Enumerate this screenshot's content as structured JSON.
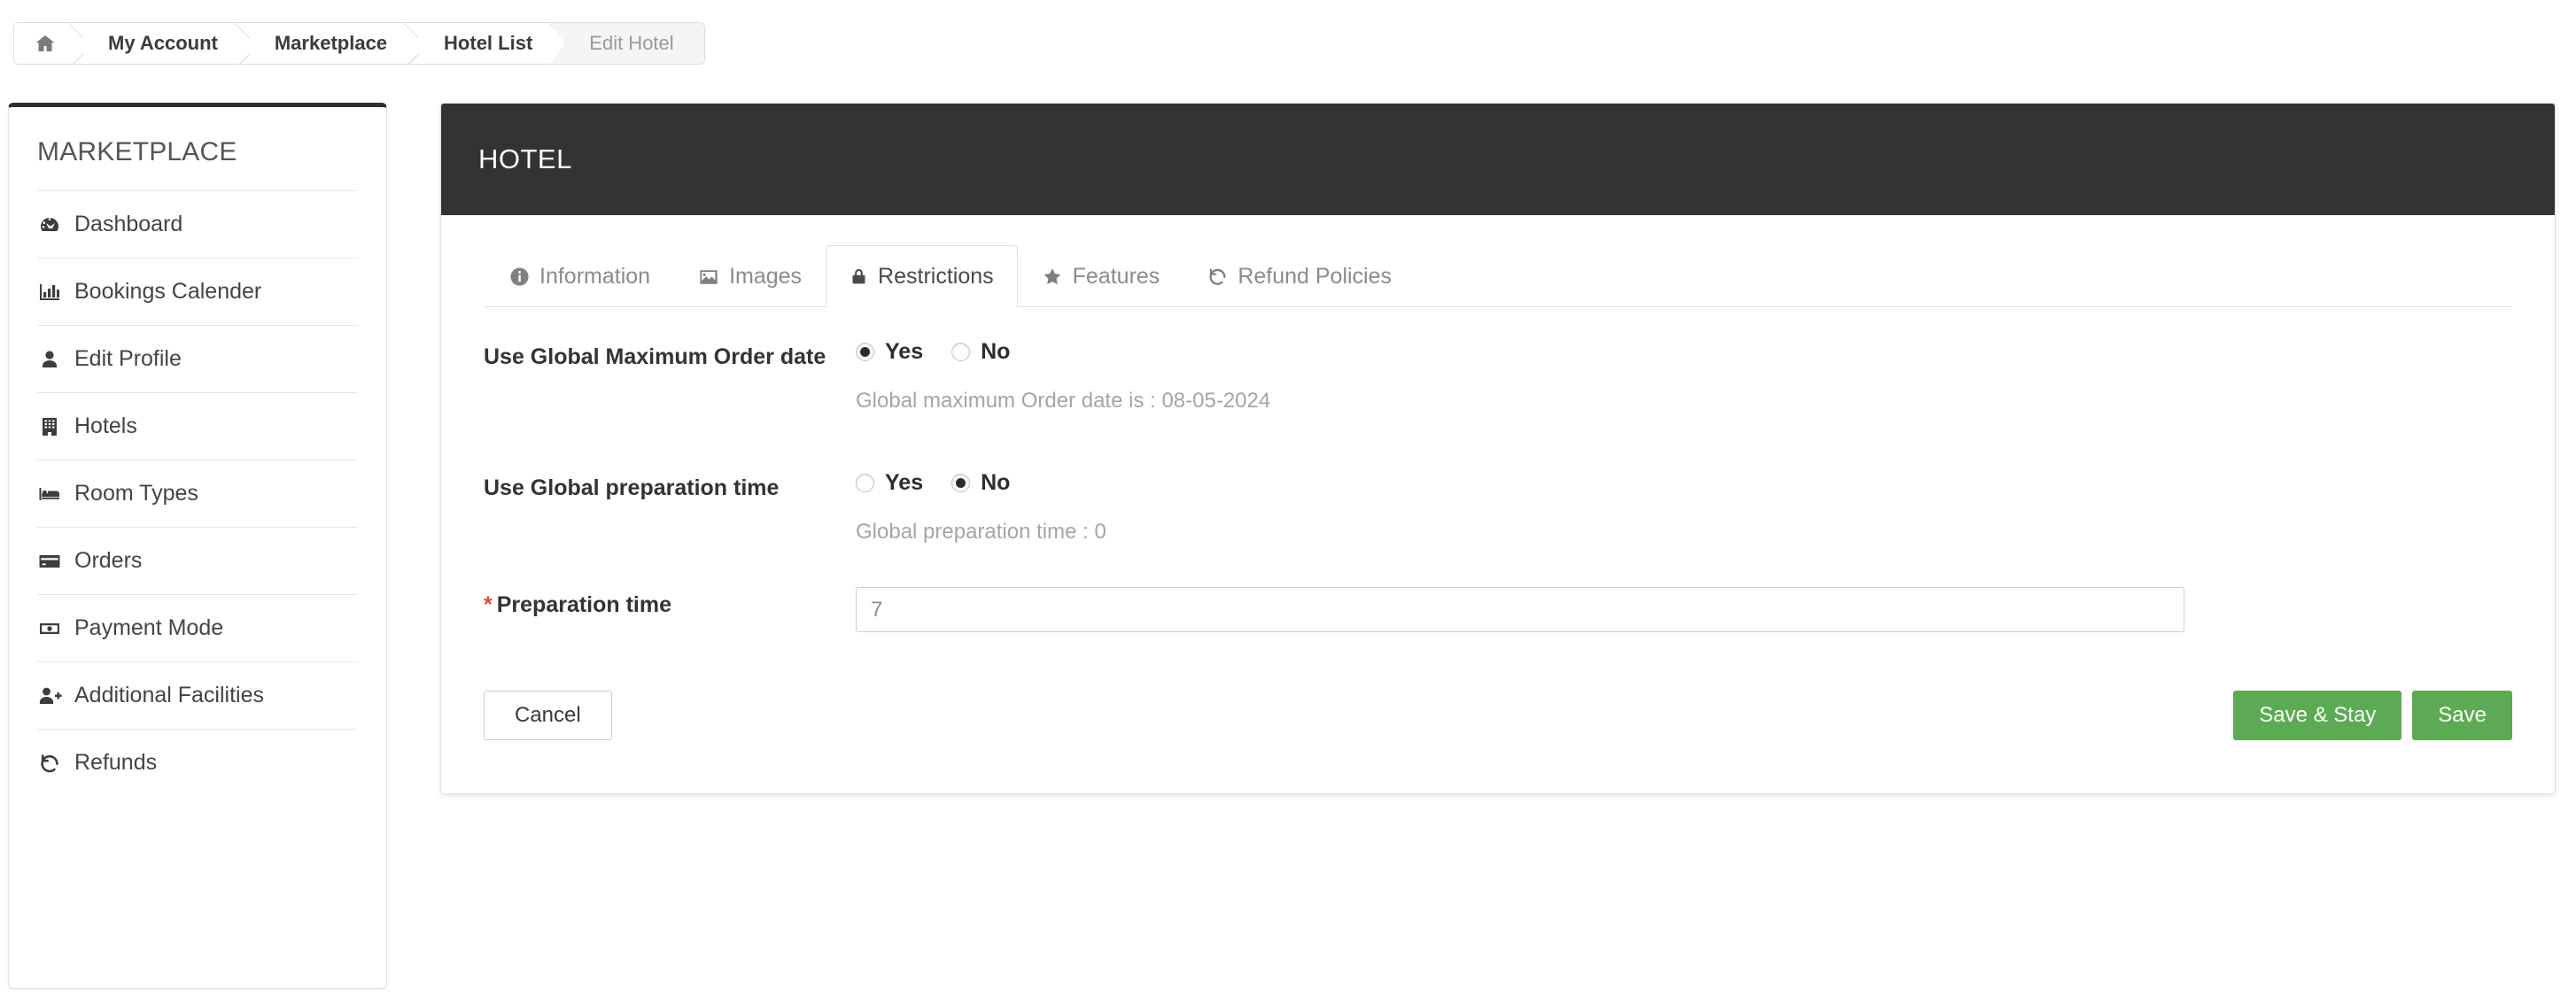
{
  "breadcrumb": {
    "home_icon": "home-icon",
    "items": [
      {
        "label": "My Account",
        "current": false
      },
      {
        "label": "Marketplace",
        "current": false
      },
      {
        "label": "Hotel List",
        "current": false
      },
      {
        "label": "Edit Hotel",
        "current": true
      }
    ]
  },
  "sidebar": {
    "title": "MARKETPLACE",
    "items": [
      {
        "label": "Dashboard",
        "icon": "dashboard-icon"
      },
      {
        "label": "Bookings Calender",
        "icon": "bar-chart-icon"
      },
      {
        "label": "Edit Profile",
        "icon": "user-icon"
      },
      {
        "label": "Hotels",
        "icon": "building-icon"
      },
      {
        "label": "Room Types",
        "icon": "bed-icon"
      },
      {
        "label": "Orders",
        "icon": "credit-card-icon"
      },
      {
        "label": "Payment Mode",
        "icon": "money-bill-icon"
      },
      {
        "label": "Additional Facilities",
        "icon": "user-plus-icon"
      },
      {
        "label": "Refunds",
        "icon": "undo-icon"
      }
    ]
  },
  "panel": {
    "title": "HOTEL",
    "tabs": [
      {
        "label": "Information",
        "icon": "info-circle-icon",
        "active": false
      },
      {
        "label": "Images",
        "icon": "image-icon",
        "active": false
      },
      {
        "label": "Restrictions",
        "icon": "lock-icon",
        "active": true
      },
      {
        "label": "Features",
        "icon": "star-icon",
        "active": false
      },
      {
        "label": "Refund Policies",
        "icon": "undo-icon",
        "active": false
      }
    ]
  },
  "form": {
    "max_order_date": {
      "label": "Use Global Maximum Order date",
      "options": [
        {
          "label": "Yes",
          "selected": true
        },
        {
          "label": "No",
          "selected": false
        }
      ],
      "hint": "Global maximum Order date is : 08-05-2024"
    },
    "preparation_time_toggle": {
      "label": "Use Global preparation time",
      "options": [
        {
          "label": "Yes",
          "selected": false
        },
        {
          "label": "No",
          "selected": true
        }
      ],
      "hint": "Global preparation time : 0"
    },
    "preparation_time": {
      "required_marker": "*",
      "label": "Preparation time",
      "value": "7",
      "placeholder": "7"
    }
  },
  "footer": {
    "cancel_label": "Cancel",
    "save_stay_label": "Save & Stay",
    "save_label": "Save"
  },
  "colors": {
    "header_dark": "#333333",
    "save_green": "#5cab54",
    "required_red": "#e8483c",
    "hint_gray": "#a5a5a5"
  }
}
